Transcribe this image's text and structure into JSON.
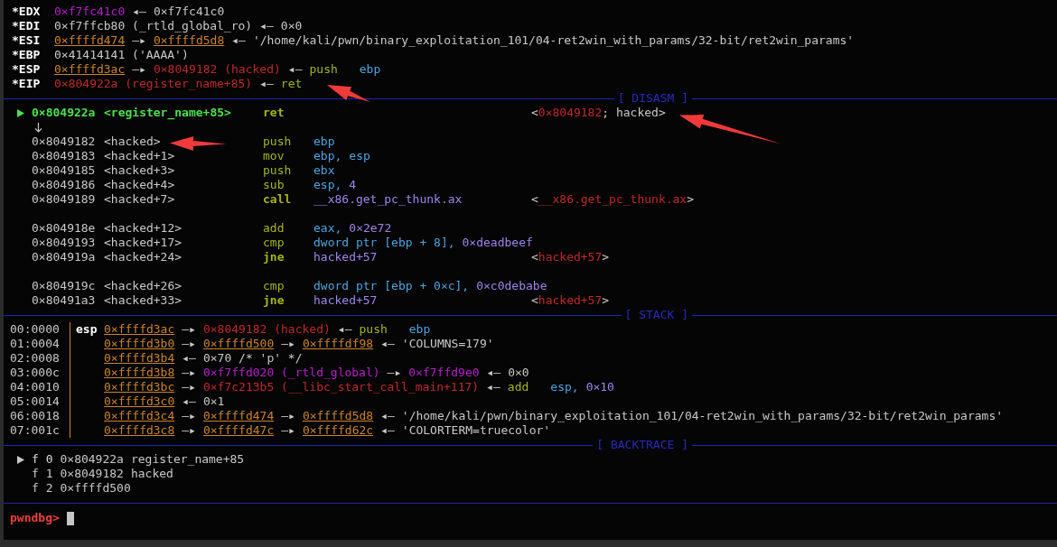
{
  "registers": [
    {
      "name": "*EDX",
      "segments": [
        {
          "kind": "data",
          "text": "0×f7fc41c0"
        },
        {
          "kind": "arrow",
          "text": "◂—"
        },
        {
          "kind": "plain",
          "text": "0×f7fc41c0"
        }
      ]
    },
    {
      "name": "*EDI",
      "segments": [
        {
          "kind": "plain",
          "text": "0×f7ffcb80 (_rtld_global_ro)"
        },
        {
          "kind": "arrow",
          "text": "◂—"
        },
        {
          "kind": "plain",
          "text": "0×0"
        }
      ]
    },
    {
      "name": "*ESI",
      "segments": [
        {
          "kind": "addr",
          "text": "0×ffffd474"
        },
        {
          "kind": "arrow",
          "text": "—▸"
        },
        {
          "kind": "addr",
          "text": "0×ffffd5d8"
        },
        {
          "kind": "arrow",
          "text": "◂—"
        },
        {
          "kind": "plain",
          "text": "'/home/kali/pwn/binary_exploitation_101/04-ret2win_with_params/32-bit/ret2win_params'"
        }
      ]
    },
    {
      "name": "*EBP",
      "segments": [
        {
          "kind": "plain",
          "text": "0×41414141 ('AAAA')"
        }
      ]
    },
    {
      "name": "*ESP",
      "segments": [
        {
          "kind": "addr",
          "text": "0×ffffd3ac"
        },
        {
          "kind": "arrow",
          "text": "—▸"
        },
        {
          "kind": "code",
          "text": "0×8049182 (hacked)"
        },
        {
          "kind": "arrow",
          "text": "◂—"
        },
        {
          "kind": "op",
          "text": "push"
        },
        {
          "kind": "reg",
          "text": "ebp"
        }
      ]
    },
    {
      "name": "*EIP",
      "segments": [
        {
          "kind": "code",
          "text": "0×804922a (register_name+85)"
        },
        {
          "kind": "arrow",
          "text": "◂—"
        },
        {
          "kind": "op",
          "text": "ret"
        }
      ]
    }
  ],
  "disasm": {
    "title": "[ DISASM ]",
    "rows": [
      {
        "kind": "insn",
        "current": true,
        "bold": true,
        "address": "0×804922a",
        "symbol": "<register_name+85>",
        "mnemonic": "ret",
        "operands": [],
        "comment": [
          {
            "kind": "plain",
            "text": "<"
          },
          {
            "kind": "code",
            "text": "0×8049182"
          },
          {
            "kind": "plain",
            "text": "; hacked>"
          }
        ]
      },
      {
        "kind": "jump"
      },
      {
        "kind": "insn",
        "current": false,
        "bold": false,
        "address": "0×8049182",
        "symbol": "<hacked>",
        "mnemonic": "push",
        "operands": [
          {
            "kind": "reg",
            "text": "ebp"
          }
        ]
      },
      {
        "kind": "insn",
        "current": false,
        "bold": false,
        "address": "0×8049183",
        "symbol": "<hacked+1>",
        "mnemonic": "mov",
        "operands": [
          {
            "kind": "reg",
            "text": "ebp,"
          },
          {
            "kind": "reg",
            "text": "esp"
          }
        ]
      },
      {
        "kind": "insn",
        "current": false,
        "bold": false,
        "address": "0×8049185",
        "symbol": "<hacked+3>",
        "mnemonic": "push",
        "operands": [
          {
            "kind": "reg",
            "text": "ebx"
          }
        ]
      },
      {
        "kind": "insn",
        "current": false,
        "bold": false,
        "address": "0×8049186",
        "symbol": "<hacked+4>",
        "mnemonic": "sub",
        "operands": [
          {
            "kind": "reg",
            "text": "esp,"
          },
          {
            "kind": "num",
            "text": "4"
          }
        ]
      },
      {
        "kind": "insn",
        "current": false,
        "bold": true,
        "address": "0×8049189",
        "symbol": "<hacked+7>",
        "mnemonic": "call",
        "operands": [
          {
            "kind": "num",
            "text": "__x86.get_pc_thunk.ax"
          }
        ],
        "comment": [
          {
            "kind": "plain",
            "text": "<"
          },
          {
            "kind": "code",
            "text": "__x86.get_pc_thunk.ax"
          },
          {
            "kind": "plain",
            "text": ">"
          }
        ]
      },
      {
        "kind": "blank"
      },
      {
        "kind": "insn",
        "current": false,
        "bold": false,
        "address": "0×804918e",
        "symbol": "<hacked+12>",
        "mnemonic": "add",
        "operands": [
          {
            "kind": "reg",
            "text": "eax,"
          },
          {
            "kind": "num",
            "text": "0×2e72"
          }
        ]
      },
      {
        "kind": "insn",
        "current": false,
        "bold": false,
        "address": "0×8049193",
        "symbol": "<hacked+17>",
        "mnemonic": "cmp",
        "operands": [
          {
            "kind": "reg",
            "text": "dword ptr [ebp + 8],"
          },
          {
            "kind": "num",
            "text": "0×deadbeef"
          }
        ]
      },
      {
        "kind": "insn",
        "current": false,
        "bold": true,
        "address": "0×804919a",
        "symbol": "<hacked+24>",
        "mnemonic": "jne",
        "operands": [
          {
            "kind": "num",
            "text": "hacked+57"
          }
        ],
        "comment": [
          {
            "kind": "plain",
            "text": "<"
          },
          {
            "kind": "code",
            "text": "hacked+57"
          },
          {
            "kind": "plain",
            "text": ">"
          }
        ]
      },
      {
        "kind": "blank"
      },
      {
        "kind": "insn",
        "current": false,
        "bold": false,
        "address": "0×804919c",
        "symbol": "<hacked+26>",
        "mnemonic": "cmp",
        "operands": [
          {
            "kind": "reg",
            "text": "dword ptr [ebp + 0×c],"
          },
          {
            "kind": "num",
            "text": "0×c0debabe"
          }
        ]
      },
      {
        "kind": "insn",
        "current": false,
        "bold": true,
        "address": "0×80491a3",
        "symbol": "<hacked+33>",
        "mnemonic": "jne",
        "operands": [
          {
            "kind": "num",
            "text": "hacked+57"
          }
        ],
        "comment": [
          {
            "kind": "plain",
            "text": "<"
          },
          {
            "kind": "code",
            "text": "hacked+57"
          },
          {
            "kind": "plain",
            "text": ">"
          }
        ]
      }
    ]
  },
  "stack": {
    "title": "[ STACK ]",
    "rows": [
      {
        "offset": "00:0000",
        "label": "esp",
        "segments": [
          {
            "kind": "addr",
            "text": "0×ffffd3ac"
          },
          {
            "kind": "arrow",
            "text": "—▸"
          },
          {
            "kind": "code",
            "text": "0×8049182 (hacked)"
          },
          {
            "kind": "arrow",
            "text": "◂—"
          },
          {
            "kind": "op",
            "text": "push"
          },
          {
            "kind": "reg",
            "text": "ebp"
          }
        ]
      },
      {
        "offset": "01:0004",
        "segments": [
          {
            "kind": "addr",
            "text": "0×ffffd3b0"
          },
          {
            "kind": "arrow",
            "text": "—▸"
          },
          {
            "kind": "addr",
            "text": "0×ffffd500"
          },
          {
            "kind": "arrow",
            "text": "—▸"
          },
          {
            "kind": "addr",
            "text": "0×ffffdf98"
          },
          {
            "kind": "arrow",
            "text": "◂—"
          },
          {
            "kind": "plain",
            "text": "'COLUMNS=179'"
          }
        ]
      },
      {
        "offset": "02:0008",
        "segments": [
          {
            "kind": "addr",
            "text": "0×ffffd3b4"
          },
          {
            "kind": "arrow",
            "text": "◂—"
          },
          {
            "kind": "plain",
            "text": "0×70 /* 'p' */"
          }
        ]
      },
      {
        "offset": "03:000c",
        "segments": [
          {
            "kind": "addr",
            "text": "0×ffffd3b8"
          },
          {
            "kind": "arrow",
            "text": "—▸"
          },
          {
            "kind": "data",
            "text": "0×f7ffd020 (_rtld_global)"
          },
          {
            "kind": "arrow",
            "text": "—▸"
          },
          {
            "kind": "data",
            "text": "0×f7ffd9e0"
          },
          {
            "kind": "arrow",
            "text": "◂—"
          },
          {
            "kind": "plain",
            "text": "0×0"
          }
        ]
      },
      {
        "offset": "04:0010",
        "segments": [
          {
            "kind": "addr",
            "text": "0×ffffd3bc"
          },
          {
            "kind": "arrow",
            "text": "—▸"
          },
          {
            "kind": "code",
            "text": "0×f7c213b5 (__libc_start_call_main+117)"
          },
          {
            "kind": "arrow",
            "text": "◂—"
          },
          {
            "kind": "op",
            "text": "add"
          },
          {
            "kind": "reg",
            "text": "esp,"
          },
          {
            "kind": "num",
            "text": "0×10"
          }
        ]
      },
      {
        "offset": "05:0014",
        "segments": [
          {
            "kind": "addr",
            "text": "0×ffffd3c0"
          },
          {
            "kind": "arrow",
            "text": "◂—"
          },
          {
            "kind": "plain",
            "text": "0×1"
          }
        ]
      },
      {
        "offset": "06:0018",
        "segments": [
          {
            "kind": "addr",
            "text": "0×ffffd3c4"
          },
          {
            "kind": "arrow",
            "text": "—▸"
          },
          {
            "kind": "addr",
            "text": "0×ffffd474"
          },
          {
            "kind": "arrow",
            "text": "—▸"
          },
          {
            "kind": "addr",
            "text": "0×ffffd5d8"
          },
          {
            "kind": "arrow",
            "text": "◂—"
          },
          {
            "kind": "plain",
            "text": "'/home/kali/pwn/binary_exploitation_101/04-ret2win_with_params/32-bit/ret2win_params'"
          }
        ]
      },
      {
        "offset": "07:001c",
        "segments": [
          {
            "kind": "addr",
            "text": "0×ffffd3c8"
          },
          {
            "kind": "arrow",
            "text": "—▸"
          },
          {
            "kind": "addr",
            "text": "0×ffffd47c"
          },
          {
            "kind": "arrow",
            "text": "—▸"
          },
          {
            "kind": "addr",
            "text": "0×ffffd62c"
          },
          {
            "kind": "arrow",
            "text": "◂—"
          },
          {
            "kind": "plain",
            "text": "'COLORTERM=truecolor'"
          }
        ]
      }
    ]
  },
  "backtrace": {
    "title": "[ BACKTRACE ]",
    "frames": [
      {
        "selected": true,
        "frame": "f 0",
        "address": "0×804922a",
        "symbol": "register_name+85"
      },
      {
        "selected": false,
        "frame": "f 1",
        "address": "0×8049182",
        "symbol": "hacked"
      },
      {
        "selected": false,
        "frame": "f 2",
        "address": "0×ffffd500"
      }
    ]
  },
  "prompt": "pwndbg>"
}
